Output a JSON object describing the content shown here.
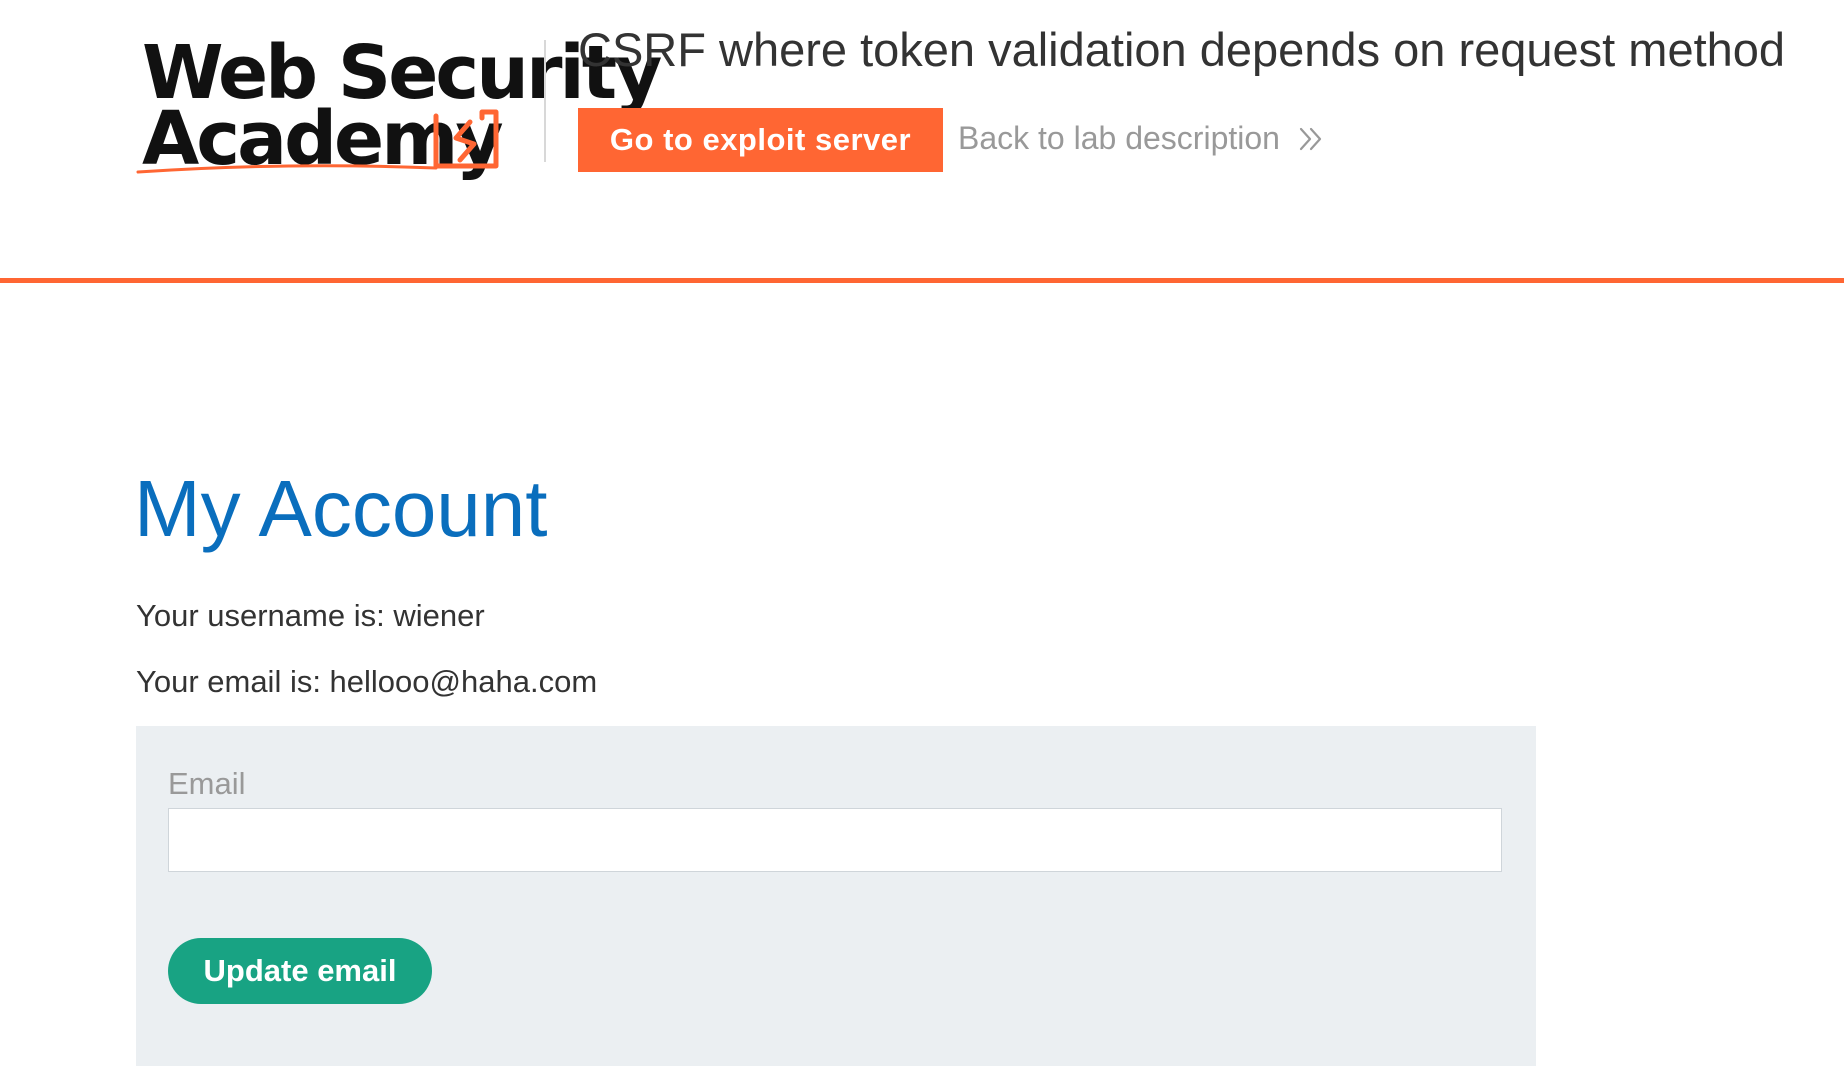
{
  "header": {
    "logo": {
      "line1": "Web Security",
      "line2": "Academy",
      "icon": "academy-flame-logo-icon"
    },
    "lab_title": "CSRF where token validation depends on request method",
    "exploit_button_label": "Go to exploit server",
    "back_link_label": "Back to lab description",
    "back_link_icon": "double-chevron-right-icon"
  },
  "main": {
    "title": "My Account",
    "username_line": "Your username is: wiener",
    "email_line": "Your email is: hellooo@haha.com",
    "form": {
      "email_label": "Email",
      "email_value": "",
      "email_placeholder": "",
      "submit_label": "Update email"
    }
  },
  "colors": {
    "accent_orange": "#ff6633",
    "title_blue": "#0a6ebd",
    "button_green": "#18a383",
    "panel_bg": "#ebeff2"
  }
}
